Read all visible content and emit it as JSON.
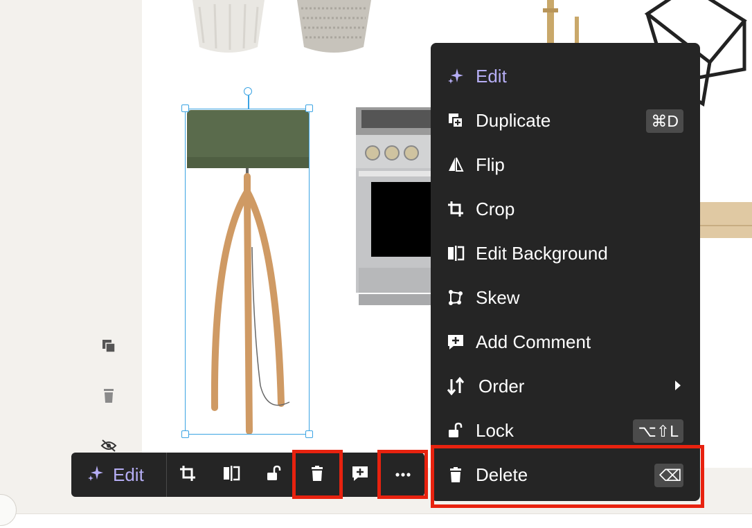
{
  "toolbar": {
    "edit_label": "Edit",
    "buttons": [
      "crop-icon",
      "edit-background-icon",
      "lock-icon",
      "trash-icon",
      "comment-add-icon",
      "more-icon"
    ],
    "more_label": "···"
  },
  "menu": {
    "edit": "Edit",
    "duplicate": "Duplicate",
    "duplicate_shortcut": "⌘D",
    "flip": "Flip",
    "crop": "Crop",
    "edit_background": "Edit Background",
    "skew": "Skew",
    "add_comment": "Add Comment",
    "order": "Order",
    "lock": "Lock",
    "lock_shortcut": "⌥⇧L",
    "delete": "Delete",
    "delete_shortcut": "⌫"
  },
  "colors": {
    "accent": "#b6aef5",
    "menu_bg": "#252525",
    "highlight": "#e8220f",
    "selection": "#3aa3e3"
  }
}
